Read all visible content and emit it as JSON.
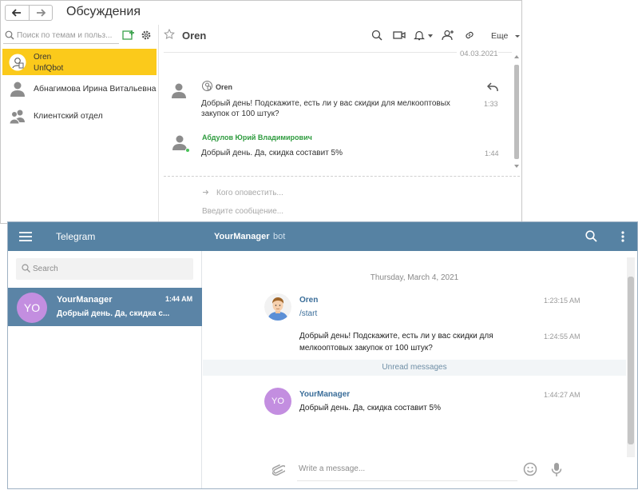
{
  "onec": {
    "title": "Обсуждения",
    "search_placeholder": "Поиск по темам и польз...",
    "conversations": [
      {
        "name": "Oren",
        "sub": "UnfQbot",
        "selected": true
      },
      {
        "name": "Абнагимова Ирина Витальевна",
        "selected": false
      },
      {
        "name": "Клиентский отдел",
        "selected": false
      }
    ],
    "chat_title": "Oren",
    "more_label": "Еще",
    "date": "04.03.2021",
    "messages": [
      {
        "sender": "Oren",
        "text": "Добрый день! Подскажите, есть ли у вас скидки для мелкооптовых закупок от 100 штук?",
        "time": "1:33"
      },
      {
        "sender": "Абдулов Юрий Владимирович",
        "text": "Добрый день. Да, скидка составит 5%",
        "time": "1:44"
      }
    ],
    "notify_placeholder": "Кого оповестить...",
    "input_placeholder": "Введите сообщение..."
  },
  "telegram": {
    "app_title": "Telegram",
    "chat_name": "YourManager",
    "chat_suffix": "bot",
    "search_placeholder": "Search",
    "dialog": {
      "initials": "YO",
      "name": "YourManager",
      "time": "1:44 AM",
      "preview": "Добрый день. Да, скидка с..."
    },
    "day_divider": "Thursday, March 4, 2021",
    "messages": [
      {
        "sender": "Oren",
        "text": "/start",
        "time": "1:23:15 AM"
      },
      {
        "text": "Добрый день! Подскажите, есть ли у вас скидки для мелкооптовых закупок от 100 штук?",
        "time": "1:24:55 AM"
      },
      {
        "sender": "YourManager",
        "initials": "YO",
        "text": "Добрый день. Да, скидка составит 5%",
        "time": "1:44:27 AM"
      }
    ],
    "unread_label": "Unread messages",
    "compose_placeholder": "Write a message..."
  },
  "colors": {
    "onec_selected": "#fbca1b",
    "tg_header": "#5682a3",
    "tg_selected": "#5b84a6",
    "tg_avatar": "#c38ee0",
    "online": "#48c258"
  }
}
